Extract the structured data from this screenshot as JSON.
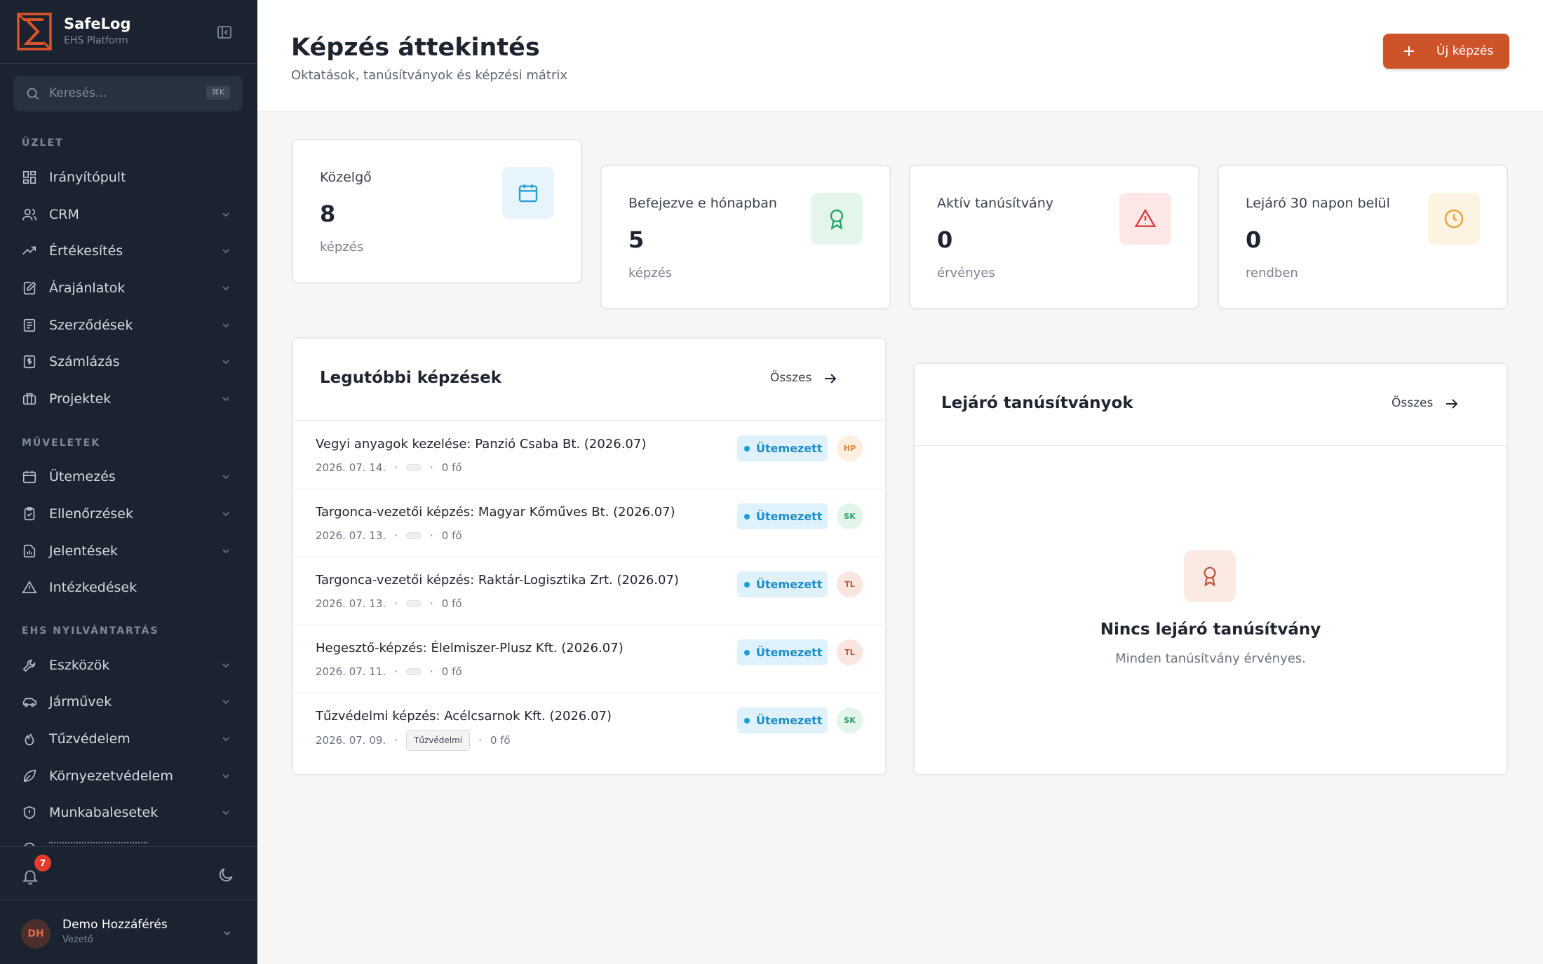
{
  "brand": {
    "name": "SafeLog",
    "subtitle": "EHS Platform"
  },
  "search": {
    "placeholder": "Keresés...",
    "shortcut": "⌘K"
  },
  "sidebar": {
    "sections": [
      {
        "label": "ÜZLET"
      },
      {
        "label": "MŰVELETEK"
      },
      {
        "label": "EHS NYILVÁNTARTÁS"
      }
    ],
    "items": [
      {
        "label": "Irányítópult",
        "icon": "dashboard-icon",
        "expandable": false
      },
      {
        "label": "CRM",
        "icon": "users-icon",
        "expandable": true
      },
      {
        "label": "Értékesítés",
        "icon": "trending-up-icon",
        "expandable": true
      },
      {
        "label": "Árajánlatok",
        "icon": "file-edit-icon",
        "expandable": true
      },
      {
        "label": "Szerződések",
        "icon": "file-text-icon",
        "expandable": true
      },
      {
        "label": "Számlázás",
        "icon": "receipt-icon",
        "expandable": true
      },
      {
        "label": "Projektek",
        "icon": "briefcase-icon",
        "expandable": true
      },
      {
        "label": "Ütemezés",
        "icon": "calendar-icon",
        "expandable": true
      },
      {
        "label": "Ellenőrzések",
        "icon": "clipboard-check-icon",
        "expandable": true
      },
      {
        "label": "Jelentések",
        "icon": "file-chart-icon",
        "expandable": true
      },
      {
        "label": "Intézkedések",
        "icon": "alert-triangle-icon",
        "expandable": false
      },
      {
        "label": "Eszközök",
        "icon": "wrench-icon",
        "expandable": true
      },
      {
        "label": "Járművek",
        "icon": "car-icon",
        "expandable": true
      },
      {
        "label": "Tűzvédelem",
        "icon": "flame-icon",
        "expandable": true
      },
      {
        "label": "Környezetvédelem",
        "icon": "leaf-icon",
        "expandable": true
      },
      {
        "label": "Munkabalesetek",
        "icon": "shield-icon",
        "expandable": true
      }
    ]
  },
  "notifications": {
    "count": "7"
  },
  "user": {
    "initials": "DH",
    "name": "Demo Hozzáférés",
    "role": "Vezető"
  },
  "page": {
    "title": "Képzés áttekintés",
    "subtitle": "Oktatások, tanúsítványok és képzési mátrix",
    "new_button": "Új képzés"
  },
  "stats": [
    {
      "label": "Közelgő",
      "value": "8",
      "unit": "képzés",
      "icon": "calendar-icon",
      "color": "#2a9fd4",
      "bg": "#e6f4fb"
    },
    {
      "label": "Befejezve e hónapban",
      "value": "5",
      "unit": "képzés",
      "icon": "award-icon",
      "color": "#2aa36a",
      "bg": "#e4f6ec"
    },
    {
      "label": "Aktív tanúsítvány",
      "value": "0",
      "unit": "érvényes",
      "icon": "alert-triangle-icon",
      "color": "#d93b3b",
      "bg": "#fde7e7"
    },
    {
      "label": "Lejáró 30 napon belül",
      "value": "0",
      "unit": "rendben",
      "icon": "clock-icon",
      "color": "#e6a23c",
      "bg": "#fdf3e3"
    }
  ],
  "recent": {
    "title": "Legutóbbi képzések",
    "link": "Összes",
    "rows": [
      {
        "title": "Vegyi anyagok kezelése: Panzió Csaba Bt. (2026.07)",
        "date": "2026. 07. 14.",
        "tag": "",
        "attendees": "0 fő",
        "status": "Ütemezett",
        "initials": "HP",
        "initials_color": "#e0893a",
        "initials_bg": "#fdeedf"
      },
      {
        "title": "Targonca-vezetői képzés: Magyar Kőműves Bt. (2026.07)",
        "date": "2026. 07. 13.",
        "tag": "",
        "attendees": "0 fő",
        "status": "Ütemezett",
        "initials": "SK",
        "initials_color": "#2aa36a",
        "initials_bg": "#e2f5ea"
      },
      {
        "title": "Targonca-vezetői képzés: Raktár-Logisztika Zrt. (2026.07)",
        "date": "2026. 07. 13.",
        "tag": "",
        "attendees": "0 fő",
        "status": "Ütemezett",
        "initials": "TL",
        "initials_color": "#c0533a",
        "initials_bg": "#fbe6df"
      },
      {
        "title": "Hegesztő-képzés: Élelmiszer-Plusz Kft. (2026.07)",
        "date": "2026. 07. 11.",
        "tag": "",
        "attendees": "0 fő",
        "status": "Ütemezett",
        "initials": "TL",
        "initials_color": "#c0533a",
        "initials_bg": "#fbe6df"
      },
      {
        "title": "Tűzvédelmi képzés: Acélcsarnok Kft. (2026.07)",
        "date": "2026. 07. 09.",
        "tag": "Tűzvédelmi",
        "attendees": "0 fő",
        "status": "Ütemezett",
        "initials": "SK",
        "initials_color": "#2aa36a",
        "initials_bg": "#e2f5ea"
      }
    ]
  },
  "expiring": {
    "title": "Lejáró tanúsítványok",
    "link": "Összes",
    "empty_title": "Nincs lejáró tanúsítvány",
    "empty_subtitle": "Minden tanúsítvány érvényes."
  }
}
